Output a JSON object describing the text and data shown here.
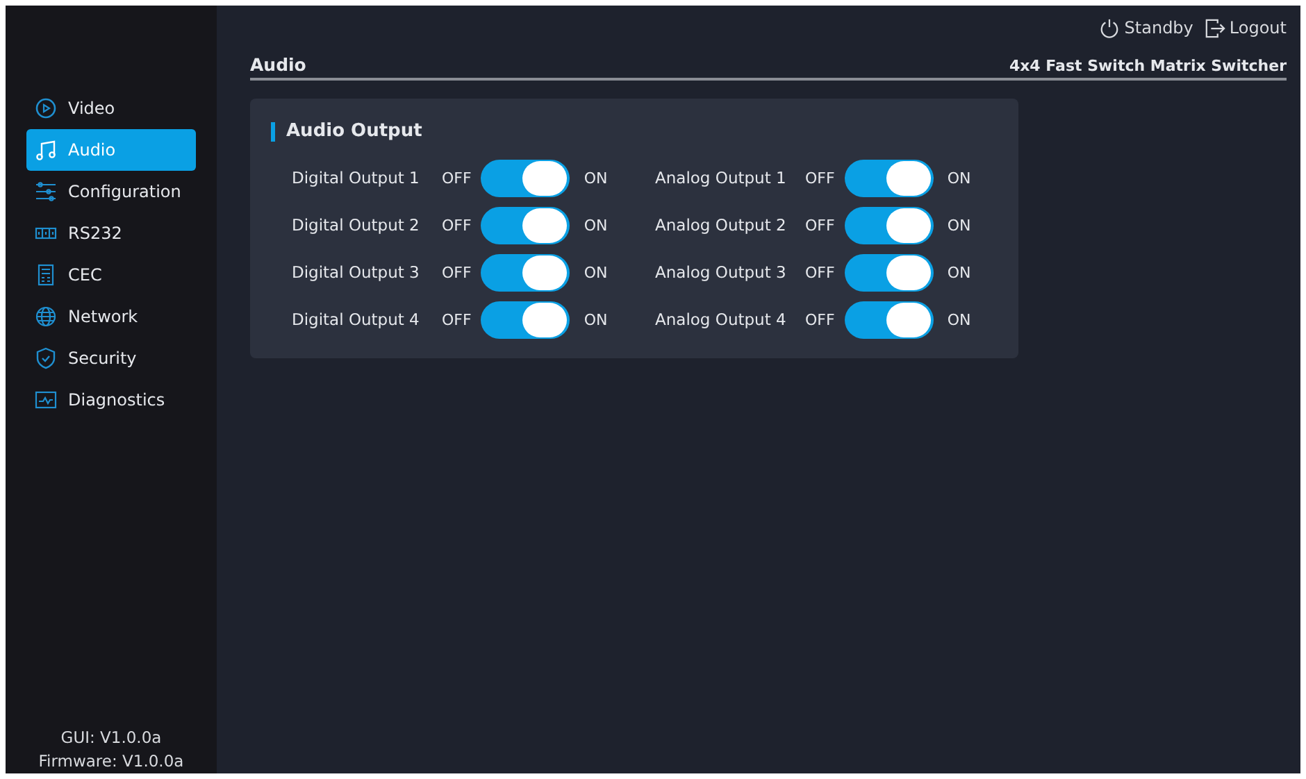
{
  "header": {
    "standby": "Standby",
    "logout": "Logout"
  },
  "sidebar": {
    "items": [
      {
        "label": "Video",
        "selected": false
      },
      {
        "label": "Audio",
        "selected": true
      },
      {
        "label": "Configuration",
        "selected": false
      },
      {
        "label": "RS232",
        "selected": false
      },
      {
        "label": "CEC",
        "selected": false
      },
      {
        "label": "Network",
        "selected": false
      },
      {
        "label": "Security",
        "selected": false
      },
      {
        "label": "Diagnostics",
        "selected": false
      }
    ],
    "gui_version": "GUI: V1.0.0a",
    "firmware_version": "Firmware: V1.0.0a"
  },
  "page": {
    "title": "Audio",
    "device": "4x4 Fast Switch Matrix Switcher"
  },
  "card": {
    "title": "Audio Output",
    "columns": [
      {
        "outputs": [
          {
            "label": "Digital Output 1",
            "off_label": "OFF",
            "on_label": "ON",
            "on": true
          },
          {
            "label": "Digital Output 2",
            "off_label": "OFF",
            "on_label": "ON",
            "on": true
          },
          {
            "label": "Digital Output 3",
            "off_label": "OFF",
            "on_label": "ON",
            "on": true
          },
          {
            "label": "Digital Output 4",
            "off_label": "OFF",
            "on_label": "ON",
            "on": true
          }
        ]
      },
      {
        "outputs": [
          {
            "label": "Analog Output 1",
            "off_label": "OFF",
            "on_label": "ON",
            "on": true
          },
          {
            "label": "Analog Output 2",
            "off_label": "OFF",
            "on_label": "ON",
            "on": true
          },
          {
            "label": "Analog Output 3",
            "off_label": "OFF",
            "on_label": "ON",
            "on": true
          },
          {
            "label": "Analog Output 4",
            "off_label": "OFF",
            "on_label": "ON",
            "on": true
          }
        ]
      }
    ]
  }
}
